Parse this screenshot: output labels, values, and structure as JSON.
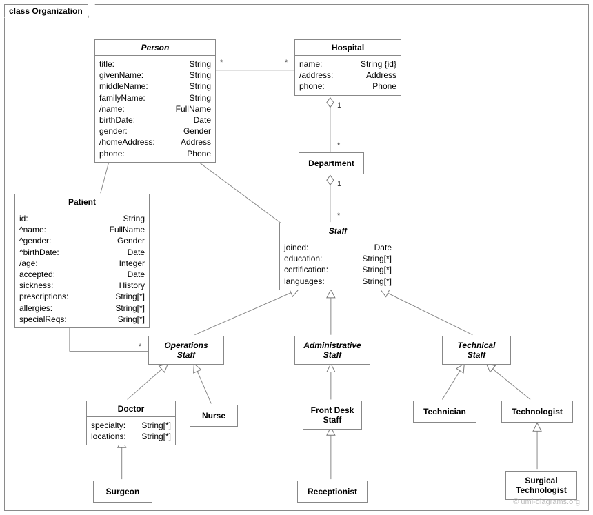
{
  "frame": {
    "title": "class Organization"
  },
  "credit": "© uml-diagrams.org",
  "classes": {
    "person": {
      "name": "Person",
      "attrs": [
        {
          "k": "title:",
          "v": "String"
        },
        {
          "k": "givenName:",
          "v": "String"
        },
        {
          "k": "middleName:",
          "v": "String"
        },
        {
          "k": "familyName:",
          "v": "String"
        },
        {
          "k": "/name:",
          "v": "FullName"
        },
        {
          "k": "birthDate:",
          "v": "Date"
        },
        {
          "k": "gender:",
          "v": "Gender"
        },
        {
          "k": "/homeAddress:",
          "v": "Address"
        },
        {
          "k": "phone:",
          "v": "Phone"
        }
      ]
    },
    "hospital": {
      "name": "Hospital",
      "attrs": [
        {
          "k": "name:",
          "v": "String {id}"
        },
        {
          "k": "/address:",
          "v": "Address"
        },
        {
          "k": "phone:",
          "v": "Phone"
        }
      ]
    },
    "department": {
      "name": "Department"
    },
    "patient": {
      "name": "Patient",
      "attrs": [
        {
          "k": "id:",
          "v": "String"
        },
        {
          "k": "^name:",
          "v": "FullName"
        },
        {
          "k": "^gender:",
          "v": "Gender"
        },
        {
          "k": "^birthDate:",
          "v": "Date"
        },
        {
          "k": "/age:",
          "v": "Integer"
        },
        {
          "k": "accepted:",
          "v": "Date"
        },
        {
          "k": "sickness:",
          "v": "History"
        },
        {
          "k": "prescriptions:",
          "v": "String[*]"
        },
        {
          "k": "allergies:",
          "v": "String[*]"
        },
        {
          "k": "specialReqs:",
          "v": "Sring[*]"
        }
      ]
    },
    "staff": {
      "name": "Staff",
      "attrs": [
        {
          "k": "joined:",
          "v": "Date"
        },
        {
          "k": "education:",
          "v": "String[*]"
        },
        {
          "k": "certification:",
          "v": "String[*]"
        },
        {
          "k": "languages:",
          "v": "String[*]"
        }
      ]
    },
    "opsStaff": {
      "name": "Operations",
      "name2": "Staff"
    },
    "adminStaff": {
      "name": "Administrative",
      "name2": "Staff"
    },
    "techStaff": {
      "name": "Technical",
      "name2": "Staff"
    },
    "doctor": {
      "name": "Doctor",
      "attrs": [
        {
          "k": "specialty:",
          "v": "String[*]"
        },
        {
          "k": "locations:",
          "v": "String[*]"
        }
      ]
    },
    "nurse": {
      "name": "Nurse"
    },
    "frontDesk": {
      "name": "Front Desk",
      "name2": "Staff"
    },
    "technician": {
      "name": "Technician"
    },
    "technologist": {
      "name": "Technologist"
    },
    "surgeon": {
      "name": "Surgeon"
    },
    "receptionist": {
      "name": "Receptionist"
    },
    "surgTech": {
      "name": "Surgical",
      "name2": "Technologist"
    }
  },
  "mults": {
    "personHospR": "*",
    "hospPersonL": "*",
    "hospDept1": "1",
    "hospDeptMany": "*",
    "deptStaff1": "1",
    "deptStaffMany": "*",
    "patientOpsP": "*",
    "patientOpsO": "*"
  }
}
